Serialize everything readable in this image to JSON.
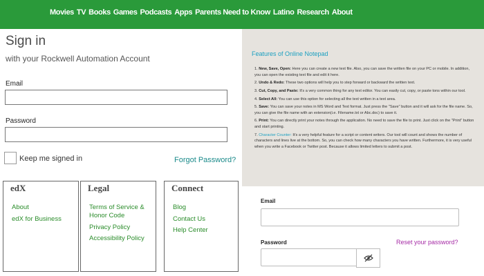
{
  "nav": {
    "items": [
      "Movies",
      "TV",
      "Books",
      "Games",
      "Podcasts",
      "Apps",
      "Parents Need to Know",
      "Latino",
      "Research",
      "About"
    ]
  },
  "signin": {
    "title": "Sign in",
    "subtitle": "with your Rockwell Automation Account",
    "email_label": "Email",
    "email_value": "",
    "password_label": "Password",
    "password_value": "",
    "keep_signed_in": "Keep me signed in",
    "forgot_password": "Forgot Password?"
  },
  "notepad": {
    "title": "Features of Online Notepad",
    "items": [
      {
        "lead": "New, Save, Open:",
        "text": " Here you can create a new text file. Also, you can save the written file on your PC or mobile. In addition, you can open the existing text file and edit it here."
      },
      {
        "lead": "Undo & Redo:",
        "text": " These two options will help you to step forward or backward the written text."
      },
      {
        "lead": "Cut, Copy, and Paste:",
        "text": " It's a very common thing for any text editor. You can easily cut, copy, or paste tons within our tool."
      },
      {
        "lead": "Select All:",
        "text": " You can use this option for selecting all the text written in a text area."
      },
      {
        "lead": "Save:",
        "text": " You can save your notes in MS Word and Text format. Just press the \"Save\" button and it will ask for the file name. So, you can give the file name with an extension(i.e. Filename.txt or Abc.doc) to save it."
      },
      {
        "lead": "Print:",
        "text": " You can directly print your notes through the application. No need to save the file to print. Just click on the \"Print\" button and start printing."
      },
      {
        "lead": "Character Counter:",
        "text": " It's a very helpful feature for a script or content writers. Our tool will count and shows the number of characters and lines live at the bottom. So, you can check how many characters you have written. Furthermore, it is very useful when you write a Facebook or Twitter post. Because it allows limited letters to submit a post."
      }
    ]
  },
  "footer": {
    "edx": {
      "title": "edX",
      "links": [
        "About",
        "edX for Business"
      ]
    },
    "legal": {
      "title": "Legal",
      "links": [
        "Terms of Service &",
        "Honor Code",
        "Privacy Policy",
        "Accessibility Policy"
      ]
    },
    "connect": {
      "title": "Connect",
      "links": [
        "Blog",
        "Contact Us",
        "Help Center"
      ]
    }
  },
  "login2": {
    "email_label": "Email",
    "email_value": "",
    "password_label": "Password",
    "password_value": "",
    "reset": "Reset your password?",
    "eye_icon": "eye-slash-icon"
  },
  "colors": {
    "nav_bg": "#2a9a3a",
    "link_teal": "#1a8a8a",
    "footer_link": "#2a8c2a",
    "reset_purple": "#a52aa5",
    "notepad_bg": "#e6e3de",
    "notepad_title": "#1a9fc0"
  }
}
